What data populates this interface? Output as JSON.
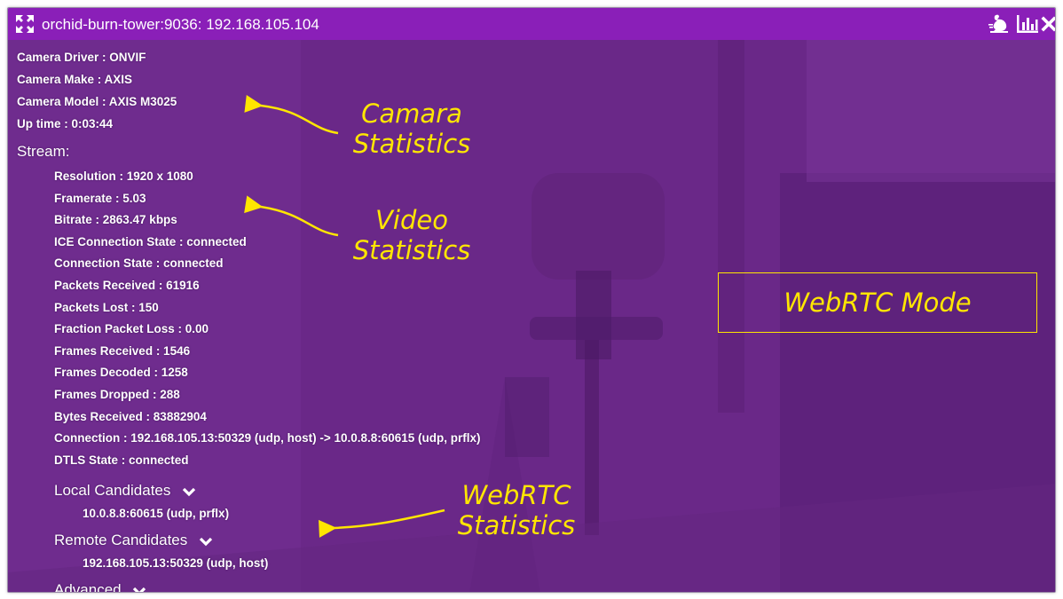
{
  "window": {
    "title": "orchid-burn-tower:9036: 192.168.105.104"
  },
  "toolbar": {
    "icons": [
      "expand-icon",
      "rabbit-speed-icon",
      "stats-chart-icon",
      "close-icon"
    ]
  },
  "camera": {
    "driver": "Camera Driver : ONVIF",
    "make": "Camera Make : AXIS",
    "model": "Camera Model : AXIS M3025",
    "uptime": "Up time : 0:03:44"
  },
  "stream": {
    "heading": "Stream:",
    "lines": [
      "Resolution : 1920 x 1080",
      "Framerate : 5.03",
      "Bitrate : 2863.47 kbps",
      "ICE Connection State : connected",
      "Connection State : connected",
      "Packets Received : 61916",
      "Packets Lost : 150",
      "Fraction Packet Loss : 0.00",
      "Frames Received : 1546",
      "Frames Decoded : 1258",
      "Frames Dropped : 288",
      "Bytes Received : 83882904",
      "Connection : 192.168.105.13:50329 (udp, host) -> 10.0.8.8:60615 (udp, prflx)",
      "DTLS State : connected"
    ]
  },
  "candidates": {
    "local_heading": "Local Candidates",
    "local_value": "10.0.8.8:60615 (udp, prflx)",
    "remote_heading": "Remote Candidates",
    "remote_value": "192.168.105.13:50329 (udp, host)",
    "advanced_heading": "Advanced"
  },
  "annotations": {
    "camera_line1": "Camara",
    "camera_line2": "Statistics",
    "video_line1": "Video",
    "video_line2": "Statistics",
    "webrtc_line1": "WebRTC",
    "webrtc_line2": "Statistics",
    "mode": "WebRTC Mode"
  },
  "colors": {
    "titlebar": "#8a1fb8",
    "video_tint": "#6f2a8e",
    "annotation": "#ffe600"
  }
}
